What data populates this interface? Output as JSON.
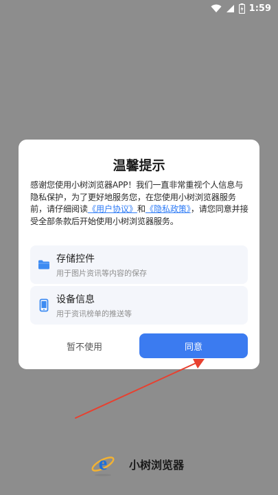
{
  "status_bar": {
    "time": "1:59",
    "icons": [
      "wifi-icon",
      "signal-icon",
      "battery-icon"
    ]
  },
  "dialog": {
    "title": "温馨提示",
    "body": {
      "part1": "感谢您使用小树浏览器APP！我们一直非常重视个人信息与隐私保护，为了更好地服务您，在您使用小树浏览器服务前，请仔细阅读",
      "link_user_agreement": "《用户协议》",
      "and": "和",
      "link_privacy_policy": "《隐私政策》",
      "part2": "，请您同意并接受全部条款后开始使用小树浏览器服务。"
    },
    "permissions": [
      {
        "icon": "folder-icon",
        "title": "存储控件",
        "description": "用于图片资讯等内容的保存"
      },
      {
        "icon": "phone-icon",
        "title": "设备信息",
        "description": "用于资讯榜单的推送等"
      }
    ],
    "buttons": {
      "cancel": "暂不使用",
      "agree": "同意"
    }
  },
  "annotation": {
    "arrow_color": "#e8402f"
  },
  "brand": {
    "name": "小树浏览器",
    "logo": "browser-logo-icon"
  },
  "colors": {
    "accent": "#3b7bf0",
    "link": "#2f7cf6",
    "overlay": "#8d8d8d"
  }
}
